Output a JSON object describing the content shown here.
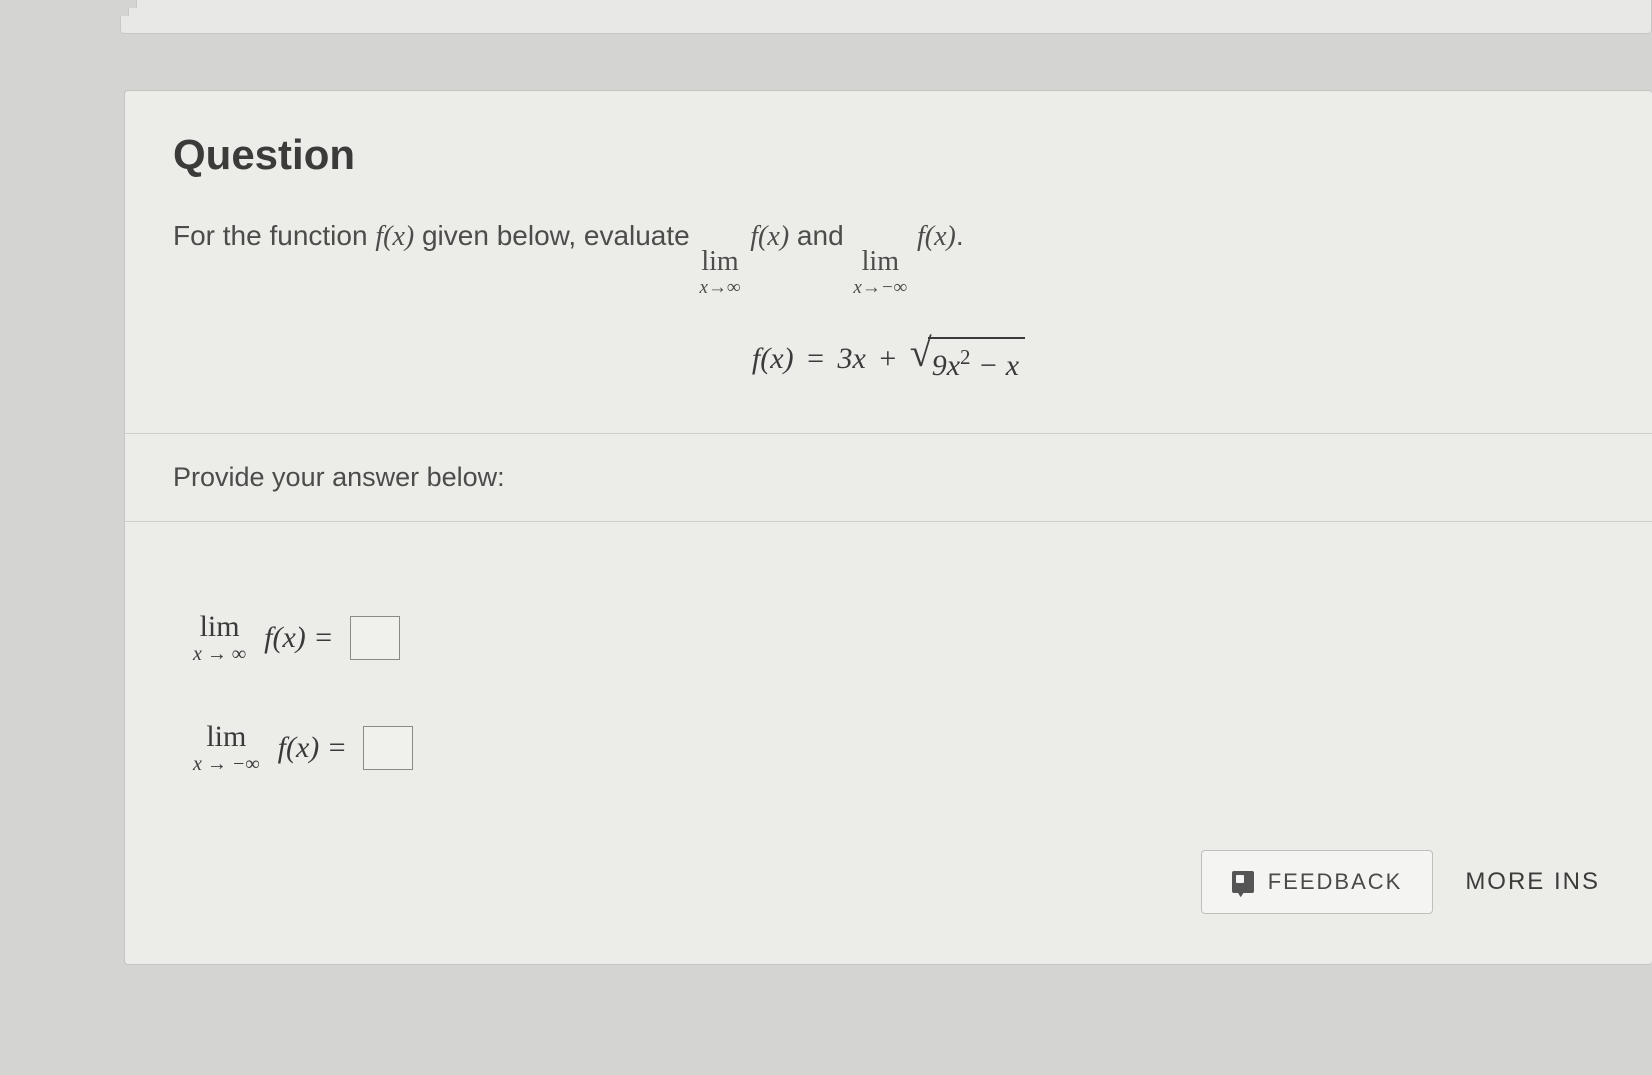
{
  "question": {
    "title": "Question",
    "intro_pre": "For the function ",
    "fx": "f(x)",
    "intro_mid": " given below, evaluate ",
    "lim_word": "lim",
    "lim_sub_pos": "x→∞",
    "lim_sub_neg": "x→−∞",
    "fx_of": "f(x)",
    "and": " and ",
    "period": ".",
    "equation": {
      "lhs": "f(x)",
      "eq": " = ",
      "a": "3x",
      "plus": " + ",
      "rad_inner_a": "9x",
      "rad_inner_exp": "2",
      "rad_inner_tail": " − x"
    }
  },
  "prompt": "Provide your answer below:",
  "answers": {
    "line1": {
      "lim": "lim",
      "sub": "x → ∞",
      "expr": "f(x) =",
      "value": ""
    },
    "line2": {
      "lim": "lim",
      "sub": "x → −∞",
      "expr": "f(x) =",
      "value": ""
    }
  },
  "buttons": {
    "feedback": "FEEDBACK",
    "more": "MORE INS"
  }
}
